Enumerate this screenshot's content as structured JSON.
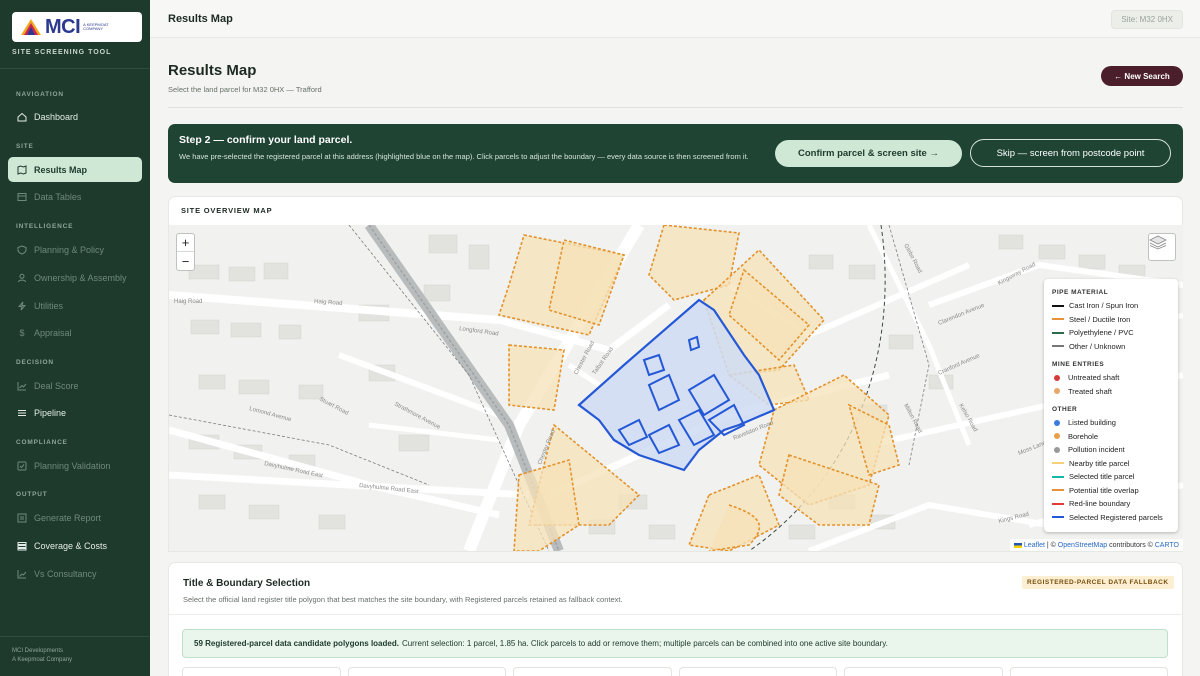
{
  "colors": {
    "sidebar_bg": "#1e3a2c",
    "active_item_bg": "#cfe8d6",
    "banner_bg": "#1f4434",
    "new_search_bg": "#4a1f2b",
    "parcel_orange": "#e3922a",
    "parcel_fill": "#f5e2b8",
    "selected_blue": "#2458d6",
    "selected_fill": "#cfdcf3"
  },
  "sidebar": {
    "logo_text": "MCI",
    "logo_sub": "A Keepmoat Company",
    "tool_name": "SITE SCREENING TOOL",
    "sections": [
      {
        "label": "NAVIGATION"
      },
      {
        "label": "SITE"
      },
      {
        "label": "INTELLIGENCE"
      },
      {
        "label": "DECISION"
      },
      {
        "label": "COMPLIANCE"
      },
      {
        "label": "OUTPUT"
      }
    ],
    "items": [
      {
        "label": "Dashboard",
        "icon": "home-icon"
      },
      {
        "label": "Results Map",
        "icon": "map-icon"
      },
      {
        "label": "Data Tables",
        "icon": "table-icon"
      },
      {
        "label": "Planning & Policy",
        "icon": "shield-icon"
      },
      {
        "label": "Ownership & Assembly",
        "icon": "user-icon"
      },
      {
        "label": "Utilities",
        "icon": "bolt-icon"
      },
      {
        "label": "Appraisal",
        "icon": "dollar-icon"
      },
      {
        "label": "Deal Score",
        "icon": "chart-icon"
      },
      {
        "label": "Pipeline",
        "icon": "list-icon"
      },
      {
        "label": "Planning Validation",
        "icon": "check-icon"
      },
      {
        "label": "Generate Report",
        "icon": "document-icon"
      },
      {
        "label": "Coverage & Costs",
        "icon": "stack-icon"
      },
      {
        "label": "Vs Consultancy",
        "icon": "trend-icon"
      }
    ],
    "footer_line1": "MCI Developments",
    "footer_line2": "A Keepmoat Company"
  },
  "topbar": {
    "title": "Results Map",
    "site_pill": "Site:  M32 0HX"
  },
  "header": {
    "title": "Results Map",
    "subtitle": "Select the land parcel for M32 0HX — Trafford",
    "new_search": "← New Search"
  },
  "step": {
    "title": "Step 2 — confirm your land parcel.",
    "description": "We have pre-selected the registered parcel at this address (highlighted blue on the map). Click parcels to adjust the boundary — every data source is then screened from it.",
    "confirm": "Confirm parcel & screen site →",
    "skip": "Skip — screen from postcode point"
  },
  "map": {
    "card_title": "SITE OVERVIEW MAP",
    "zoom_in": "+",
    "zoom_out": "−",
    "streets": [
      {
        "label": "Haig Road"
      },
      {
        "label": "Haig Road"
      },
      {
        "label": "Longford Road"
      },
      {
        "label": "Lomond Avenue"
      },
      {
        "label": "Stuart Road"
      },
      {
        "label": "Strathmore Avenue"
      },
      {
        "label": "Davyhulme Road East"
      },
      {
        "label": "Davyhulme Road East"
      },
      {
        "label": "Chester Road"
      },
      {
        "label": "Chester Road"
      },
      {
        "label": "Talbot Road"
      },
      {
        "label": "Ravelston Road"
      },
      {
        "label": "Kings Road"
      },
      {
        "label": "Clarendon Avenue"
      },
      {
        "label": "Cranford Avenue"
      },
      {
        "label": "Glebe Road"
      },
      {
        "label": "Milton Road"
      },
      {
        "label": "Kelso Road"
      },
      {
        "label": "Kingsway Road"
      },
      {
        "label": "Moss Lane"
      }
    ],
    "legend": {
      "groups": [
        {
          "heading": "PIPE MATERIAL",
          "items": [
            {
              "label": "Cast Iron / Spun Iron",
              "color": "#111111",
              "kind": "line"
            },
            {
              "label": "Steel / Ductile Iron",
              "color": "#e8913a",
              "kind": "line"
            },
            {
              "label": "Polyethylene / PVC",
              "color": "#2e6b4a",
              "kind": "line"
            },
            {
              "label": "Other / Unknown",
              "color": "#777777",
              "kind": "line"
            }
          ]
        },
        {
          "heading": "MINE ENTRIES",
          "items": [
            {
              "label": "Untreated shaft",
              "color": "#d63a3a",
              "kind": "dot"
            },
            {
              "label": "Treated shaft",
              "color": "#e8a86a",
              "kind": "dot"
            }
          ]
        },
        {
          "heading": "OTHER",
          "items": [
            {
              "label": "Listed building",
              "color": "#3a7be0",
              "kind": "dot"
            },
            {
              "label": "Borehole",
              "color": "#e8a04a",
              "kind": "dot"
            },
            {
              "label": "Pollution incident",
              "color": "#999999",
              "kind": "dot"
            },
            {
              "label": "Nearby title parcel",
              "color": "#f5d27a",
              "kind": "line"
            },
            {
              "label": "Selected title parcel",
              "color": "#14b8a6",
              "kind": "line"
            },
            {
              "label": "Potential title overlap",
              "color": "#e8913a",
              "kind": "line"
            },
            {
              "label": "Red-line boundary",
              "color": "#e03a3a",
              "kind": "line"
            },
            {
              "label": "Selected Registered parcels",
              "color": "#2458d6",
              "kind": "line"
            }
          ]
        }
      ]
    },
    "attribution": {
      "leaflet": "Leaflet",
      "sep": " | © ",
      "osm": "OpenStreetMap",
      "contrib": " contributors © ",
      "carto": "CARTO"
    }
  },
  "title_selection": {
    "title": "Title & Boundary Selection",
    "description": "Select the official land register title polygon that best matches the site boundary, with Registered parcels retained as fallback context.",
    "badge": "REGISTERED-PARCEL DATA FALLBACK",
    "notice_bold": "59 Registered-parcel data candidate polygons loaded.",
    "notice_rest": "Current selection: 1 parcel, 1.85 ha. Click parcels to add or remove them; multiple parcels can be combined into one active site boundary."
  }
}
